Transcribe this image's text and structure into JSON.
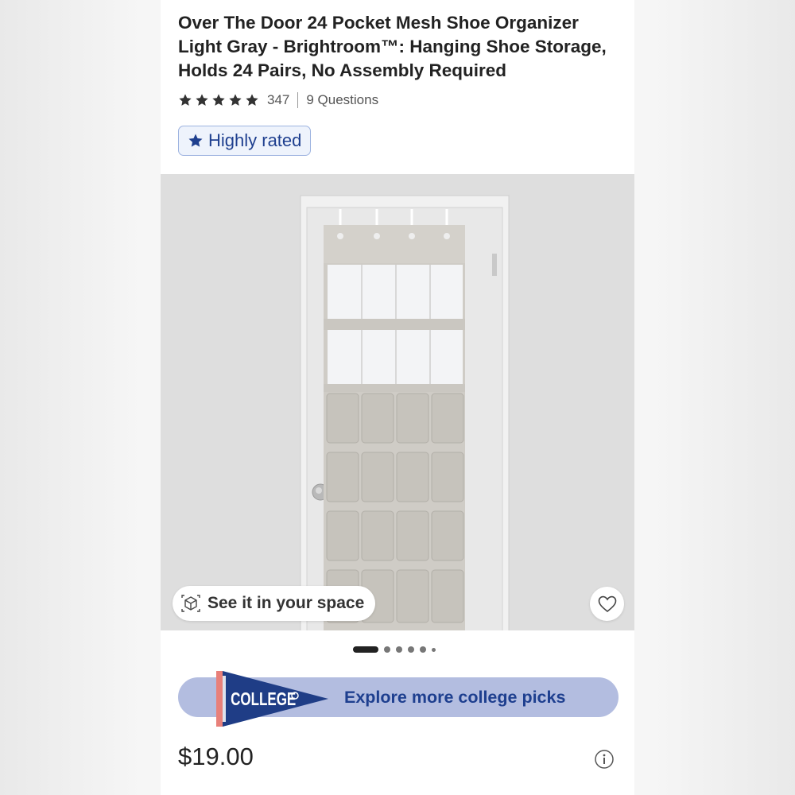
{
  "product": {
    "title": "Over The Door 24 Pocket Mesh Shoe Organizer Light Gray - Brightroom™: Hanging Shoe Storage, Holds 24 Pairs, No Assembly Required",
    "rating_stars": 5,
    "review_count": "347",
    "questions": "9 Questions",
    "badge": "Highly rated",
    "price": "$19.00"
  },
  "gallery": {
    "see_in_space": "See it in your space",
    "image_count": 6,
    "active_index": 0
  },
  "promo": {
    "pennant_text": "COLLEGE",
    "label": "Explore more college picks"
  },
  "icons": {
    "star": "star-icon",
    "badge": "star-icon",
    "ar": "ar-cube-icon",
    "favorite": "heart-icon",
    "info": "info-icon"
  },
  "colors": {
    "accent": "#1e3f8f",
    "badge_bg": "#eef3fc",
    "promo_bg": "#b3bde0",
    "pennant": "#1f3d86",
    "pennant_stripe": "#e8807a"
  }
}
